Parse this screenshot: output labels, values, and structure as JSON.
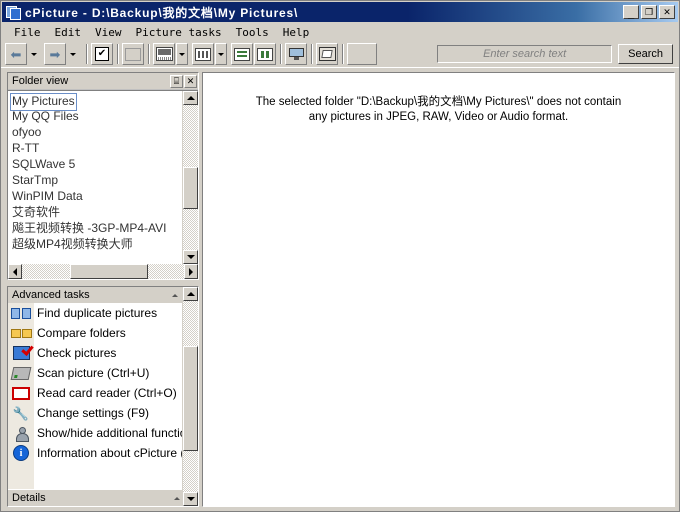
{
  "window": {
    "title": "cPicture - D:\\Backup\\我的文档\\My Pictures\\",
    "icon": "pictures-stack-icon",
    "minimize_label": "_",
    "maximize_label": "❒",
    "close_label": "✕"
  },
  "menubar": {
    "items": [
      {
        "label": "File"
      },
      {
        "label": "Edit"
      },
      {
        "label": "View"
      },
      {
        "label": "Picture tasks"
      },
      {
        "label": "Tools"
      },
      {
        "label": "Help"
      }
    ]
  },
  "toolbar": {
    "buttons": [
      {
        "name": "back-button",
        "icon": "arrow-left-icon"
      },
      {
        "name": "forward-button",
        "icon": "arrow-right-icon"
      },
      {
        "name": "select-all-button",
        "icon": "checkbox-icon"
      },
      {
        "name": "full-screen-button",
        "icon": "rectangle-icon"
      },
      {
        "name": "thumbnail-view-button",
        "icon": "thumbnail-icon"
      },
      {
        "name": "grid-view-button",
        "icon": "grid-icon"
      },
      {
        "name": "list-view-button",
        "icon": "list-icon"
      },
      {
        "name": "column-view-button",
        "icon": "columns-icon"
      },
      {
        "name": "slideshow-button",
        "icon": "monitor-icon"
      },
      {
        "name": "print-button",
        "icon": "print-box-icon"
      },
      {
        "name": "blank-button",
        "icon": "blank-icon"
      }
    ],
    "search": {
      "placeholder": "Enter search text",
      "value": "",
      "button_label": "Search"
    }
  },
  "folder_panel": {
    "title": "Folder view",
    "pin_label": "⌸",
    "close_label": "✕",
    "items": [
      {
        "label": "My Pictures",
        "selected": true
      },
      {
        "label": "My QQ Files",
        "selected": false
      },
      {
        "label": "ofyoo",
        "selected": false
      },
      {
        "label": "R-TT",
        "selected": false
      },
      {
        "label": "SQLWave 5",
        "selected": false
      },
      {
        "label": "StarTmp",
        "selected": false
      },
      {
        "label": "WinPIM Data",
        "selected": false
      },
      {
        "label": "艾奇软件",
        "selected": false
      },
      {
        "label": "飚王视频转换 -3GP-MP4-AVI",
        "selected": false
      },
      {
        "label": "超级MP4视频转换大师",
        "selected": false
      }
    ]
  },
  "tasks_panel": {
    "title": "Advanced tasks",
    "collapse_label": "▲",
    "items": [
      {
        "label": "Find duplicate pictures",
        "icon": "duplicate-pictures-icon"
      },
      {
        "label": "Compare folders",
        "icon": "compare-folders-icon"
      },
      {
        "label": "Check pictures",
        "icon": "check-pictures-icon"
      },
      {
        "label": "Scan picture (Ctrl+U)",
        "icon": "scanner-icon"
      },
      {
        "label": "Read card reader (Ctrl+O)",
        "icon": "card-reader-icon"
      },
      {
        "label": "Change settings (F9)",
        "icon": "wrench-icon"
      },
      {
        "label": "Show/hide additional function",
        "icon": "person-icon"
      },
      {
        "label": "Information about cPicture (F",
        "icon": "info-icon"
      }
    ]
  },
  "details_bar": {
    "title": "Details",
    "collapse_label": "▲",
    "expand_label": "▼"
  },
  "main": {
    "message_line1": "The selected folder \"D:\\Backup\\我的文档\\My Pictures\\\" does not contain",
    "message_line2": "any pictures in JPEG, RAW, Video or Audio format."
  },
  "colors": {
    "title_bar_start": "#0a246a",
    "title_bar_end": "#a6caf0",
    "window_face": "#d4d0c8",
    "selection_border": "#6a8ec7",
    "content_background": "#ffffff"
  }
}
